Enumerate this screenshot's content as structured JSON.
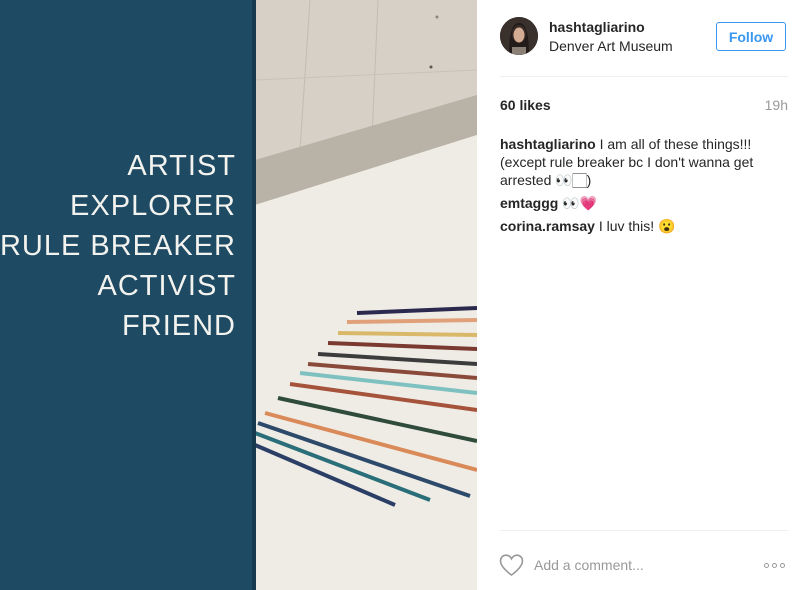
{
  "post": {
    "image": {
      "wall_words": [
        "ARTIST",
        "EXPLORER",
        "RULE BREAKER",
        "ACTIVIST",
        "FRIEND"
      ],
      "wall_color": "#1f4a63",
      "stripe_colors": [
        "#2b2a4e",
        "#e0a07a",
        "#d9b86a",
        "#7a3a30",
        "#3c3c3c",
        "#8a4a3a",
        "#7fc1c0",
        "#a5533a",
        "#2f4b3a",
        "#d98a58",
        "#2e4a6a",
        "#2a6e7a",
        "#2b3f66"
      ]
    },
    "header": {
      "username": "hashtagliarino",
      "location": "Denver Art Museum",
      "follow_label": "Follow"
    },
    "likes": "60 likes",
    "time": "19h",
    "comments": [
      {
        "user": "hashtagliarino",
        "text": " I am all of these things!!! (except rule breaker bc I don't wanna get arrested 👀🏻)"
      },
      {
        "user": "emtaggg",
        "text": " 👀💗"
      },
      {
        "user": "corina.ramsay",
        "text": " I luv this! 😮"
      }
    ],
    "footer": {
      "comment_placeholder": "Add a comment...",
      "like_icon": "heart-icon",
      "more_icon": "more-options-icon"
    }
  }
}
